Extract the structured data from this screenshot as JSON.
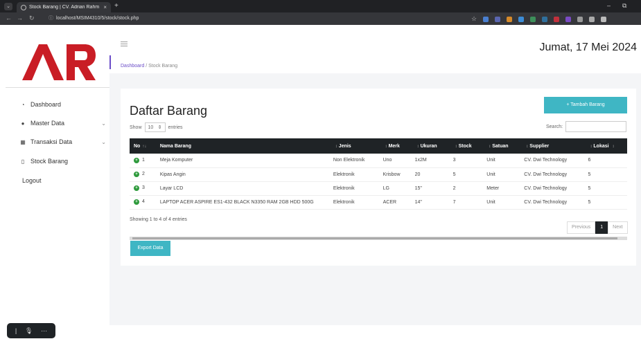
{
  "browser": {
    "tab_title": "Stock Barang | CV. Adrian Rahm",
    "tab_close": "×",
    "new_tab": "+",
    "url": "localhost/MSIM4310/5/stock/stock.php",
    "window_min": "–",
    "window_restore": "⧉"
  },
  "logo": {
    "text": "AR",
    "color": "#c91d25"
  },
  "sidebar": {
    "items": [
      {
        "label": "Dashboard",
        "icon": "dashboard-icon",
        "has_chevron": false
      },
      {
        "label": "Master Data",
        "icon": "database-icon",
        "has_chevron": true
      },
      {
        "label": "Transaksi Data",
        "icon": "table-icon",
        "has_chevron": true
      },
      {
        "label": "Stock Barang",
        "icon": "document-icon",
        "has_chevron": false
      },
      {
        "label": "Logout",
        "icon": "",
        "has_chevron": false
      }
    ]
  },
  "header": {
    "date": "Jumat, 17 Mei 2024",
    "breadcrumb_link": "Dashboard",
    "breadcrumb_sep": "/",
    "breadcrumb_current": "Stock Barang"
  },
  "card": {
    "title": "Daftar Barang",
    "add_button": "+ Tambah Barang",
    "show_label": "Show",
    "entries_value": "10",
    "entries_label": "entries",
    "search_label": "Search:",
    "info": "Showing 1 to 4 of 4 entries",
    "pager": {
      "previous": "Previous",
      "current": "1",
      "next": "Next"
    },
    "export_button": "Export Data"
  },
  "table": {
    "columns": [
      "No",
      "Nama Barang",
      "Jenis",
      "Merk",
      "Ukuran",
      "Stock",
      "Satuan",
      "Supplier",
      "Lokasi"
    ],
    "rows": [
      [
        "1",
        "Meja Komputer",
        "Non Elektronik",
        "Uno",
        "1x2M",
        "3",
        "Unit",
        "CV. Dwi Technology",
        "6"
      ],
      [
        "2",
        "Kipas Angin",
        "Elektronik",
        "Krisbow",
        "20",
        "5",
        "Unit",
        "CV. Dwi Technology",
        "5"
      ],
      [
        "3",
        "Layar LCD",
        "Elektronik",
        "LG",
        "15\"",
        "2",
        "Meter",
        "CV. Dwi Technology",
        "5"
      ],
      [
        "4",
        "LAPTOP ACER ASPIRE ES1-432 BLACK N3350 RAM 2GB HDD 500G",
        "Elektronik",
        "ACER",
        "14\"",
        "7",
        "Unit",
        "CV. Dwi Technology",
        "5"
      ]
    ]
  },
  "colors": {
    "accent": "#3fb6c4",
    "header_dark": "#1f2326",
    "breadcrumb_link": "#6a4cc8",
    "row_expand": "#2e9a3c"
  }
}
